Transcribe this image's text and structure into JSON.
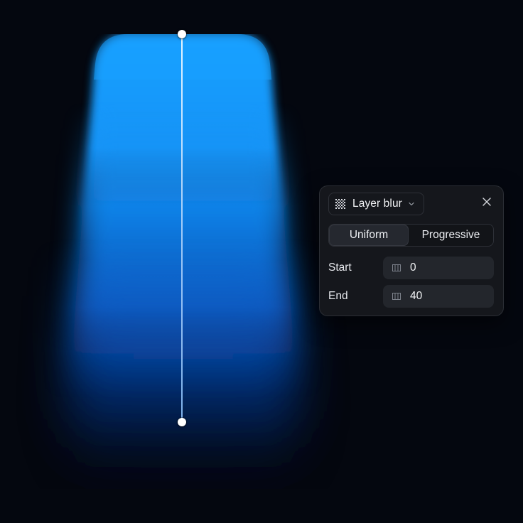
{
  "canvas": {
    "background": "#04070f",
    "layer_color": "#1aa0ff",
    "gradient_handles": [
      "start-handle",
      "end-handle"
    ]
  },
  "panel": {
    "effect_select": {
      "icon": "layer-blur-icon",
      "label": "Layer blur",
      "chevron": "chevron-down-icon"
    },
    "close_icon": "close-icon",
    "blur_type": {
      "options": [
        "Uniform",
        "Progressive"
      ],
      "selected": "Uniform"
    },
    "fields": {
      "start": {
        "label": "Start",
        "value": "0",
        "icon": "drag-scrub-icon"
      },
      "end": {
        "label": "End",
        "value": "40",
        "icon": "drag-scrub-icon"
      }
    }
  }
}
